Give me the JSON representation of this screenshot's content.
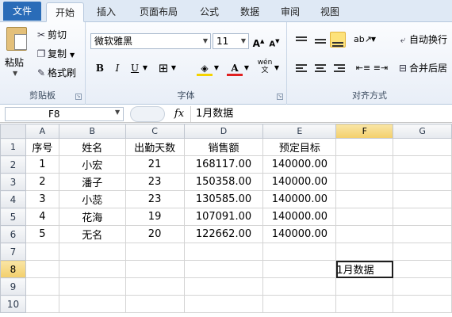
{
  "tabs": [
    "文件",
    "开始",
    "插入",
    "页面布局",
    "公式",
    "数据",
    "审阅",
    "视图"
  ],
  "ribbon": {
    "clipboard": {
      "paste": "粘贴",
      "cut": "剪切",
      "copy": "复制",
      "format_painter": "格式刷",
      "group_label": "剪贴板"
    },
    "font": {
      "name": "微软雅黑",
      "size": "11",
      "bold": "B",
      "italic": "I",
      "underline": "U",
      "group_label": "字体"
    },
    "alignment": {
      "wrap_text": "自动换行",
      "merge_center": "合并后居",
      "group_label": "对齐方式"
    }
  },
  "formula_bar": {
    "name_box": "F8",
    "fx": "fx",
    "content": "1月数据"
  },
  "sheet": {
    "columns": [
      "A",
      "B",
      "C",
      "D",
      "E",
      "F",
      "G"
    ],
    "selected_column": "F",
    "selected_row": 8,
    "rows": [
      {
        "n": "1",
        "cells": [
          "序号",
          "姓名",
          "出勤天数",
          "销售额",
          "预定目标",
          "",
          ""
        ]
      },
      {
        "n": "2",
        "cells": [
          "1",
          "小宏",
          "21",
          "168117.00",
          "140000.00",
          "",
          ""
        ]
      },
      {
        "n": "3",
        "cells": [
          "2",
          "潘子",
          "23",
          "150358.00",
          "140000.00",
          "",
          ""
        ]
      },
      {
        "n": "4",
        "cells": [
          "3",
          "小蕊",
          "23",
          "130585.00",
          "140000.00",
          "",
          ""
        ]
      },
      {
        "n": "5",
        "cells": [
          "4",
          "花海",
          "19",
          "107091.00",
          "140000.00",
          "",
          ""
        ]
      },
      {
        "n": "6",
        "cells": [
          "5",
          "无名",
          "20",
          "122662.00",
          "140000.00",
          "",
          ""
        ]
      },
      {
        "n": "7",
        "cells": [
          "",
          "",
          "",
          "",
          "",
          "",
          ""
        ]
      },
      {
        "n": "8",
        "cells": [
          "",
          "",
          "",
          "",
          "",
          "1月数据",
          ""
        ]
      },
      {
        "n": "9",
        "cells": [
          "",
          "",
          "",
          "",
          "",
          "",
          ""
        ]
      },
      {
        "n": "10",
        "cells": [
          "",
          "",
          "",
          "",
          "",
          "",
          ""
        ]
      }
    ]
  },
  "colors": {
    "file_tab": "#2a6cb8",
    "selection_header": "#f3cf6b",
    "align_highlight": "#fde27a"
  }
}
